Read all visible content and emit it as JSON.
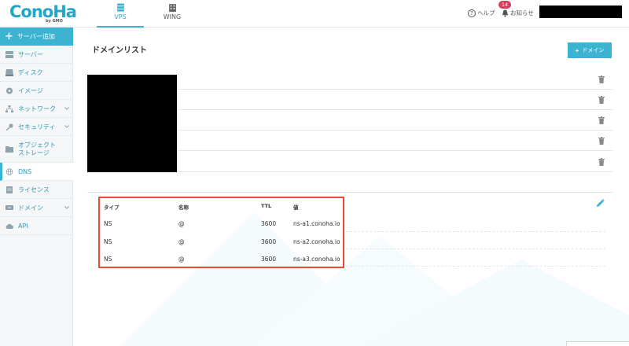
{
  "header": {
    "logo_text": "ConoHa",
    "logo_sub": "by GMO",
    "tabs": [
      {
        "label": "VPS",
        "active": true
      },
      {
        "label": "WING",
        "active": false
      }
    ],
    "help_label": "ヘルプ",
    "notice_label": "お知らせ",
    "notice_count": "14"
  },
  "sidebar": {
    "add_label": "サーバー追加",
    "items": [
      {
        "label": "サーバー",
        "icon": "server-icon"
      },
      {
        "label": "ディスク",
        "icon": "disk-icon"
      },
      {
        "label": "イメージ",
        "icon": "image-icon"
      },
      {
        "label": "ネットワーク",
        "icon": "network-icon",
        "has_chevron": true
      },
      {
        "label": "セキュリティ",
        "icon": "key-icon",
        "has_chevron": true
      },
      {
        "label_line1": "オブジェクト",
        "label_line2": "ストレージ",
        "icon": "folder-icon"
      },
      {
        "label": "DNS",
        "icon": "globe-icon",
        "active": true
      },
      {
        "label": "ライセンス",
        "icon": "license-icon"
      },
      {
        "label": "ドメイン",
        "icon": "domain-icon",
        "has_chevron": true
      },
      {
        "label": "API",
        "icon": "cloud-icon"
      }
    ]
  },
  "main": {
    "title": "ドメインリスト",
    "add_domain_label": "ドメイン",
    "dns_table": {
      "headers": [
        "タイプ",
        "名称",
        "TTL",
        "値"
      ],
      "rows": [
        [
          "NS",
          "@",
          "3600",
          "ns-a1.conoha.io"
        ],
        [
          "NS",
          "@",
          "3600",
          "ns-a2.conoha.io"
        ],
        [
          "NS",
          "@",
          "3600",
          "ns-a3.conoha.io"
        ]
      ]
    }
  },
  "colors": {
    "accent": "#3bb4d2",
    "highlight_border": "#e84a33",
    "badge": "#d6405d"
  }
}
